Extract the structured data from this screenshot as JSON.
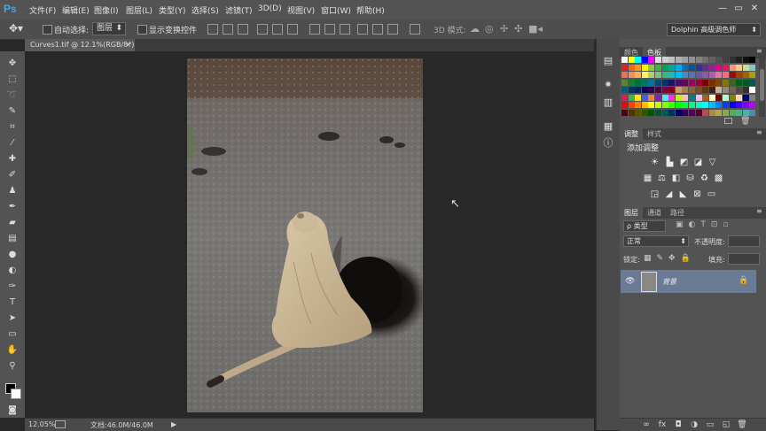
{
  "app": {
    "logo": "Ps"
  },
  "menu": [
    "文件(F)",
    "编辑(E)",
    "图像(I)",
    "图层(L)",
    "类型(Y)",
    "选择(S)",
    "滤镜(T)",
    "3D(D)",
    "视图(V)",
    "窗口(W)",
    "帮助(H)"
  ],
  "window_controls": {
    "minimize": "—",
    "restore": "▭",
    "close": "✕"
  },
  "options_bar": {
    "auto_select_label": "自动选择:",
    "auto_select_value": "图层",
    "show_transform_label": "显示变换控件",
    "mode_3d_label": "3D 模式:"
  },
  "workspace": {
    "name": "Dolphin 高级调色师"
  },
  "document": {
    "tab_title": "Curves1.tif @ 12.1%(RGB/8*)",
    "close": "×"
  },
  "status_bar": {
    "zoom": "12.05%",
    "doc_size": "文档:46.0M/46.0M"
  },
  "panels": {
    "color_tabs": [
      "颜色",
      "色板"
    ],
    "adjust_tabs": [
      "调整",
      "样式"
    ],
    "adjust_title": "添加调整",
    "layers_tabs": [
      "图层",
      "通道",
      "路径"
    ],
    "kind_filter": "ρ 类型",
    "blend_mode": "正常",
    "opacity_label": "不透明度:",
    "lock_label": "锁定:",
    "fill_label": "填充:",
    "layer_name": "背景"
  },
  "colors": {
    "menubar": "#535353",
    "panel": "#535353",
    "canvas_bg": "#282828",
    "selected_layer": "#6b7b95",
    "logo": "#4aa3e6"
  },
  "icons": {
    "tools": [
      "move-icon",
      "marquee-icon",
      "lasso-icon",
      "quick-select-icon",
      "crop-icon",
      "eyedropper-icon",
      "healing-brush-icon",
      "brush-icon",
      "clone-stamp-icon",
      "history-brush-icon",
      "eraser-icon",
      "gradient-icon",
      "blur-icon",
      "dodge-icon",
      "pen-icon",
      "type-icon",
      "path-select-icon",
      "rectangle-icon",
      "hand-icon",
      "zoom-icon"
    ]
  }
}
